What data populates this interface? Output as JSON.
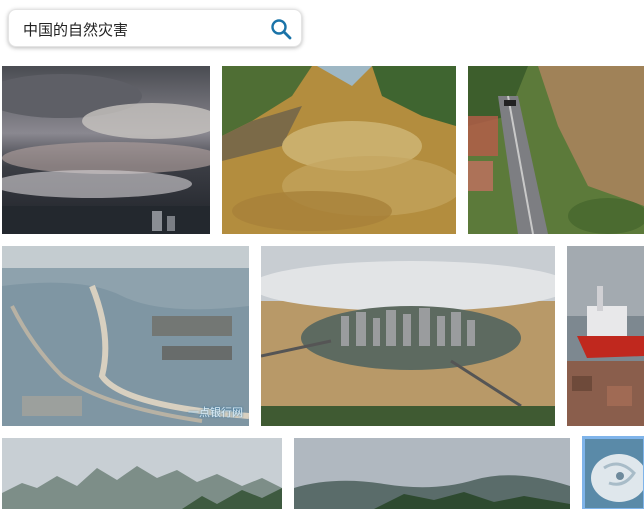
{
  "search": {
    "query": "中国的自然灾害",
    "button_icon": "search-icon",
    "accent_color": "#1a73a8"
  },
  "results": [
    {
      "row": 1,
      "subject": "storm-clouds"
    },
    {
      "row": 1,
      "subject": "flood-river"
    },
    {
      "row": 1,
      "subject": "landslide-highway"
    },
    {
      "row": 2,
      "subject": "flooded-coast",
      "watermark": "一点银行网"
    },
    {
      "row": 2,
      "subject": "flooded-city"
    },
    {
      "row": 2,
      "subject": "typhoon-ship"
    },
    {
      "row": 3,
      "subject": "karst-mountains"
    },
    {
      "row": 3,
      "subject": "misty-lake"
    },
    {
      "row": 3,
      "subject": "satellite-typhoon",
      "selected": true
    }
  ]
}
